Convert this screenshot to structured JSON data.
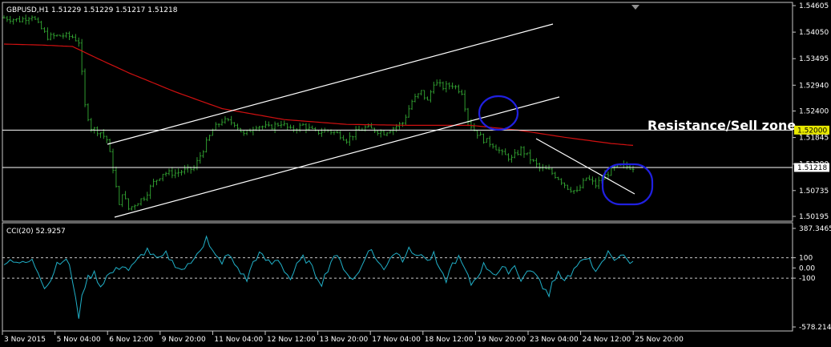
{
  "colors": {
    "background": "#000000",
    "frame": "#c8c8c8",
    "bars": "#2f9a2f",
    "ma": "#d01010",
    "trendlines": "#ffffff",
    "hline": "#ffffff",
    "yellow_line": "#e8e800",
    "circle": "#2020e0",
    "cci_line": "#20b0c8",
    "text": "#ffffff",
    "yellow_tag_bg": "#e8e800",
    "yellow_tag_text": "#000000",
    "price_tag_bg": "#ffffff",
    "price_tag_text": "#000000"
  },
  "chart_data": [
    {
      "type": "ohlc",
      "title": "GBPUSD,H1  1.51229 1.51229 1.51217 1.51218",
      "ylim": [
        1.50195,
        1.54605
      ],
      "ytick_labels": [
        "1.54605",
        "1.54050",
        "1.53495",
        "1.52940",
        "1.52400",
        "1.51845",
        "1.51290",
        "1.50735",
        "1.50195"
      ],
      "ytick_values": [
        1.54605,
        1.5405,
        1.53495,
        1.5294,
        1.524,
        1.51845,
        1.5129,
        1.50735,
        1.50195
      ],
      "xtick_labels": [
        "3 Nov 2015",
        "5 Nov 04:00",
        "6 Nov 12:00",
        "9 Nov 20:00",
        "11 Nov 04:00",
        "12 Nov 12:00",
        "13 Nov 20:00",
        "17 Nov 04:00",
        "18 Nov 12:00",
        "19 Nov 20:00",
        "23 Nov 04:00",
        "24 Nov 12:00",
        "25 Nov 20:00"
      ],
      "close_key_points": [
        [
          0,
          1.5435
        ],
        [
          5,
          1.543
        ],
        [
          9,
          1.544
        ],
        [
          11,
          1.542
        ],
        [
          14,
          1.5395
        ],
        [
          19,
          1.5398
        ],
        [
          22,
          1.5395
        ],
        [
          24,
          1.5385
        ],
        [
          26,
          1.525
        ],
        [
          28,
          1.5205
        ],
        [
          31,
          1.5195
        ],
        [
          33,
          1.518
        ],
        [
          35,
          1.512
        ],
        [
          36,
          1.508
        ],
        [
          37,
          1.504
        ],
        [
          38,
          1.507
        ],
        [
          40,
          1.5035
        ],
        [
          45,
          1.506
        ],
        [
          48,
          1.509
        ],
        [
          51,
          1.511
        ],
        [
          55,
          1.511
        ],
        [
          58,
          1.5115
        ],
        [
          61,
          1.512
        ],
        [
          64,
          1.516
        ],
        [
          67,
          1.52
        ],
        [
          70,
          1.522
        ],
        [
          74,
          1.5215
        ],
        [
          77,
          1.519
        ],
        [
          81,
          1.521
        ],
        [
          85,
          1.5205
        ],
        [
          89,
          1.5215
        ],
        [
          92,
          1.52
        ],
        [
          96,
          1.521
        ],
        [
          100,
          1.5195
        ],
        [
          104,
          1.52
        ],
        [
          108,
          1.519
        ],
        [
          110,
          1.518
        ],
        [
          113,
          1.5195
        ],
        [
          116,
          1.5205
        ],
        [
          119,
          1.52
        ],
        [
          122,
          1.5195
        ],
        [
          125,
          1.5205
        ],
        [
          128,
          1.5215
        ],
        [
          131,
          1.526
        ],
        [
          134,
          1.528
        ],
        [
          136,
          1.526
        ],
        [
          138,
          1.53
        ],
        [
          141,
          1.529
        ],
        [
          144,
          1.5295
        ],
        [
          147,
          1.528
        ],
        [
          149,
          1.522
        ],
        [
          151,
          1.52
        ],
        [
          154,
          1.518
        ],
        [
          157,
          1.517
        ],
        [
          160,
          1.515
        ],
        [
          163,
          1.514
        ],
        [
          166,
          1.516
        ],
        [
          169,
          1.514
        ],
        [
          172,
          1.512
        ],
        [
          175,
          1.5115
        ],
        [
          178,
          1.51
        ],
        [
          181,
          1.508
        ],
        [
          184,
          1.507
        ],
        [
          187,
          1.51
        ],
        [
          190,
          1.5085
        ],
        [
          193,
          1.5105
        ],
        [
          196,
          1.512
        ],
        [
          199,
          1.5125
        ],
        [
          202,
          1.5122
        ]
      ],
      "ma_key_points": [
        [
          0,
          1.538
        ],
        [
          12,
          1.5378
        ],
        [
          22,
          1.5375
        ],
        [
          30,
          1.535
        ],
        [
          40,
          1.532
        ],
        [
          55,
          1.528
        ],
        [
          70,
          1.5245
        ],
        [
          90,
          1.5222
        ],
        [
          110,
          1.5212
        ],
        [
          130,
          1.521
        ],
        [
          150,
          1.521
        ],
        [
          165,
          1.52
        ],
        [
          180,
          1.5185
        ],
        [
          195,
          1.5172
        ],
        [
          202,
          1.5168
        ]
      ],
      "resistance_line": 1.52,
      "resistance_label": "1.52000",
      "current_price_line": 1.51218,
      "current_price_label": "1.51218",
      "annotation": "Resistance/Sell zone"
    },
    {
      "type": "line",
      "title": "CCI(20) 52.9257",
      "ylim": [
        -578.214,
        387.3465
      ],
      "ytick_labels": [
        "387.3465",
        "100",
        "0.00",
        "-100",
        "-578.214"
      ],
      "ytick_values": [
        387.3465,
        100,
        0,
        -100,
        -578.214
      ],
      "levels": [
        100,
        -100
      ],
      "key_points": [
        [
          0,
          60
        ],
        [
          3,
          80
        ],
        [
          6,
          40
        ],
        [
          9,
          70
        ],
        [
          11,
          -40
        ],
        [
          13,
          -180
        ],
        [
          15,
          -120
        ],
        [
          17,
          50
        ],
        [
          19,
          80
        ],
        [
          21,
          40
        ],
        [
          23,
          -300
        ],
        [
          24,
          -520
        ],
        [
          25,
          -250
        ],
        [
          27,
          -100
        ],
        [
          29,
          -50
        ],
        [
          31,
          -180
        ],
        [
          33,
          -80
        ],
        [
          36,
          -20
        ],
        [
          38,
          30
        ],
        [
          40,
          -20
        ],
        [
          42,
          40
        ],
        [
          44,
          120
        ],
        [
          46,
          180
        ],
        [
          48,
          110
        ],
        [
          50,
          80
        ],
        [
          52,
          140
        ],
        [
          54,
          60
        ],
        [
          57,
          -20
        ],
        [
          60,
          40
        ],
        [
          62,
          160
        ],
        [
          64,
          220
        ],
        [
          65,
          300
        ],
        [
          66,
          200
        ],
        [
          68,
          110
        ],
        [
          70,
          60
        ],
        [
          72,
          130
        ],
        [
          74,
          40
        ],
        [
          76,
          -40
        ],
        [
          78,
          -120
        ],
        [
          80,
          60
        ],
        [
          82,
          140
        ],
        [
          84,
          80
        ],
        [
          86,
          40
        ],
        [
          88,
          90
        ],
        [
          90,
          -20
        ],
        [
          92,
          -110
        ],
        [
          94,
          20
        ],
        [
          96,
          100
        ],
        [
          98,
          50
        ],
        [
          100,
          -60
        ],
        [
          102,
          -150
        ],
        [
          104,
          -10
        ],
        [
          106,
          130
        ],
        [
          108,
          60
        ],
        [
          110,
          -40
        ],
        [
          112,
          -120
        ],
        [
          114,
          -40
        ],
        [
          116,
          120
        ],
        [
          118,
          180
        ],
        [
          120,
          60
        ],
        [
          122,
          -20
        ],
        [
          124,
          110
        ],
        [
          126,
          160
        ],
        [
          128,
          80
        ],
        [
          130,
          220
        ],
        [
          132,
          100
        ],
        [
          134,
          150
        ],
        [
          136,
          60
        ],
        [
          138,
          130
        ],
        [
          140,
          -40
        ],
        [
          142,
          -120
        ],
        [
          144,
          40
        ],
        [
          146,
          100
        ],
        [
          148,
          -20
        ],
        [
          150,
          -160
        ],
        [
          152,
          -80
        ],
        [
          154,
          30
        ],
        [
          156,
          -20
        ],
        [
          158,
          -60
        ],
        [
          160,
          -10
        ],
        [
          162,
          -30
        ],
        [
          164,
          20
        ],
        [
          166,
          -110
        ],
        [
          168,
          -40
        ],
        [
          170,
          -20
        ],
        [
          172,
          -140
        ],
        [
          174,
          -220
        ],
        [
          175,
          -300
        ],
        [
          176,
          -140
        ],
        [
          178,
          -40
        ],
        [
          180,
          -110
        ],
        [
          182,
          -60
        ],
        [
          184,
          20
        ],
        [
          186,
          60
        ],
        [
          188,
          120
        ],
        [
          190,
          -60
        ],
        [
          192,
          40
        ],
        [
          194,
          150
        ],
        [
          196,
          90
        ],
        [
          198,
          130
        ],
        [
          200,
          80
        ],
        [
          202,
          50
        ]
      ]
    }
  ]
}
